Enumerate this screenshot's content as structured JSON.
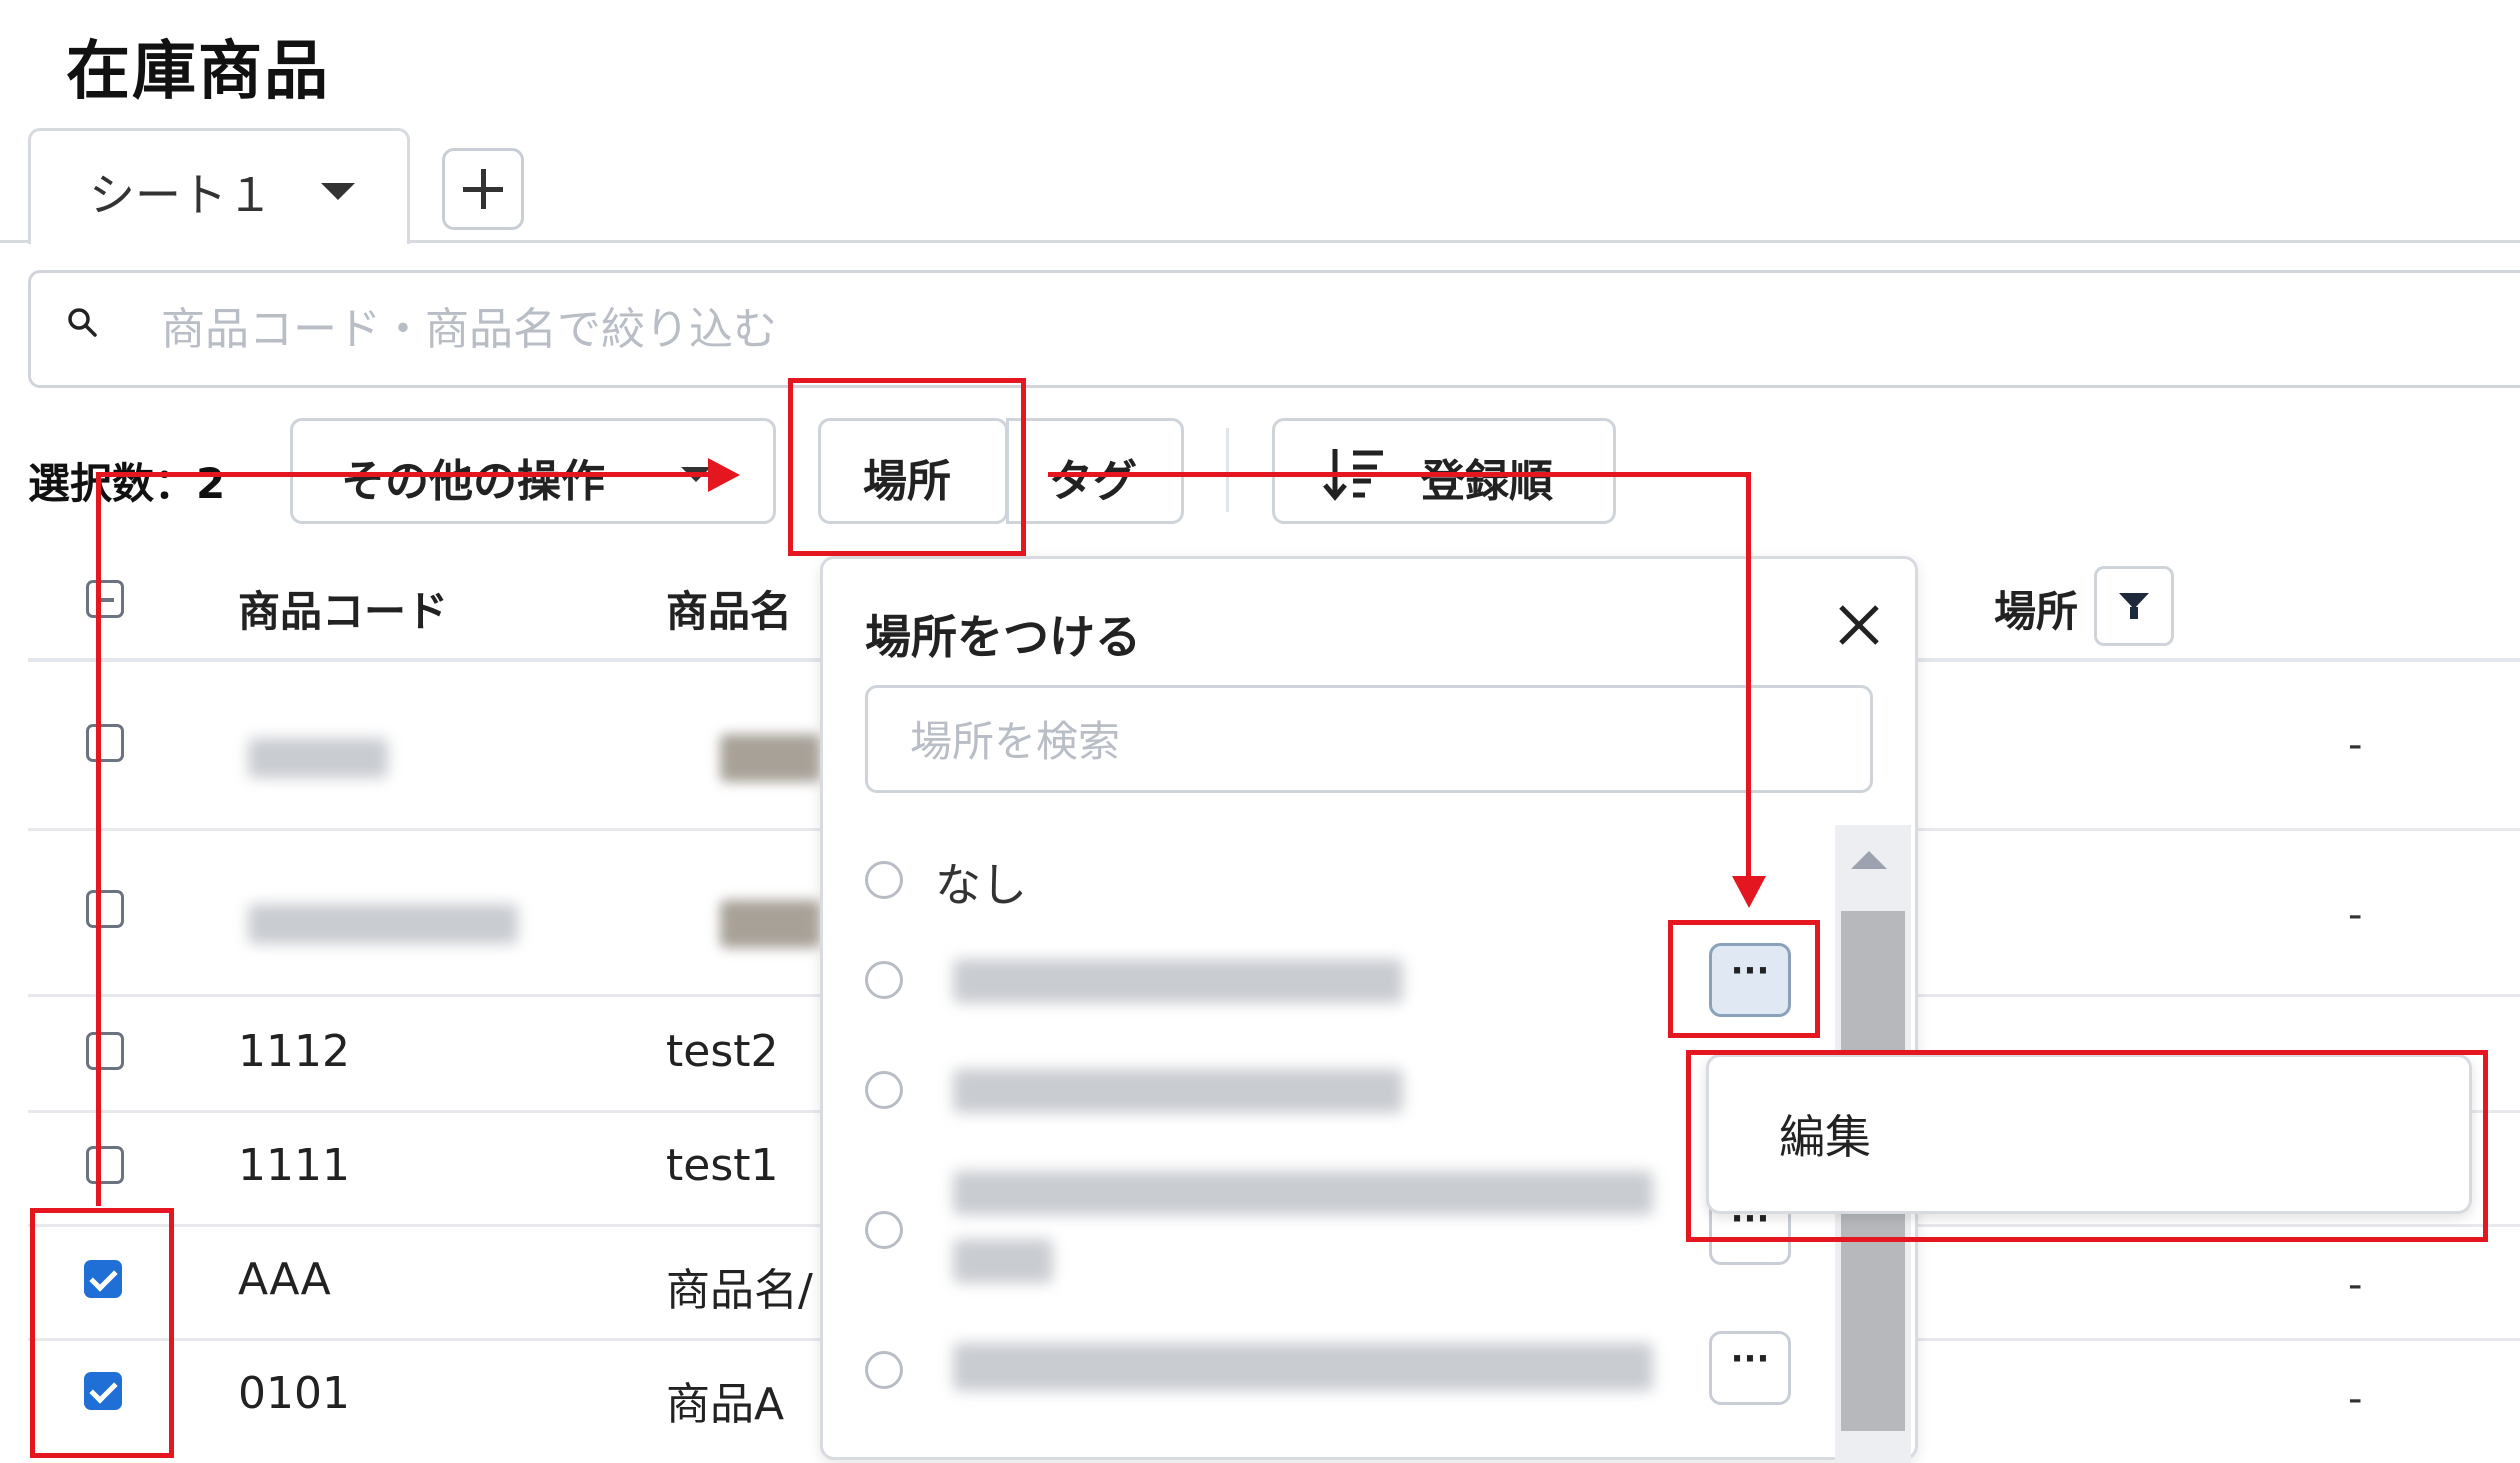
{
  "page": {
    "title": "在庫商品"
  },
  "tabs": {
    "sheet_label": "シート１",
    "add_label": "+"
  },
  "search": {
    "placeholder": "商品コード・商品名で絞り込む"
  },
  "toolbar": {
    "selection_count": "選択数：2",
    "other_actions": "その他の操作",
    "place": "場所",
    "tag": "タグ",
    "sort": "登録順"
  },
  "table": {
    "headers": {
      "code": "商品コード",
      "name": "商品名",
      "place": "場所"
    },
    "rows": [
      {
        "code": "",
        "name": "",
        "place": "-",
        "checked": false,
        "blurred": true
      },
      {
        "code": "",
        "name": "",
        "place": "-",
        "checked": false,
        "blurred": true
      },
      {
        "code": "1112",
        "name": "test2",
        "place": "",
        "checked": false
      },
      {
        "code": "1111",
        "name": "test1",
        "place": "",
        "checked": false
      },
      {
        "code": "AAA",
        "name": "商品名/",
        "place": "-",
        "checked": true
      },
      {
        "code": "0101",
        "name": "商品A",
        "place": "-",
        "checked": true
      }
    ]
  },
  "place_popup": {
    "title": "場所をつける",
    "search_placeholder": "場所を検索",
    "options": [
      {
        "label": "なし"
      },
      {
        "label": ""
      },
      {
        "label": ""
      },
      {
        "label": ""
      },
      {
        "label": ""
      }
    ],
    "more_label": "···"
  },
  "context_menu": {
    "edit": "編集"
  },
  "colors": {
    "annotation_red": "#e4161f",
    "checkbox_blue": "#1f6fd6",
    "border_gray": "#d7dbe0"
  }
}
